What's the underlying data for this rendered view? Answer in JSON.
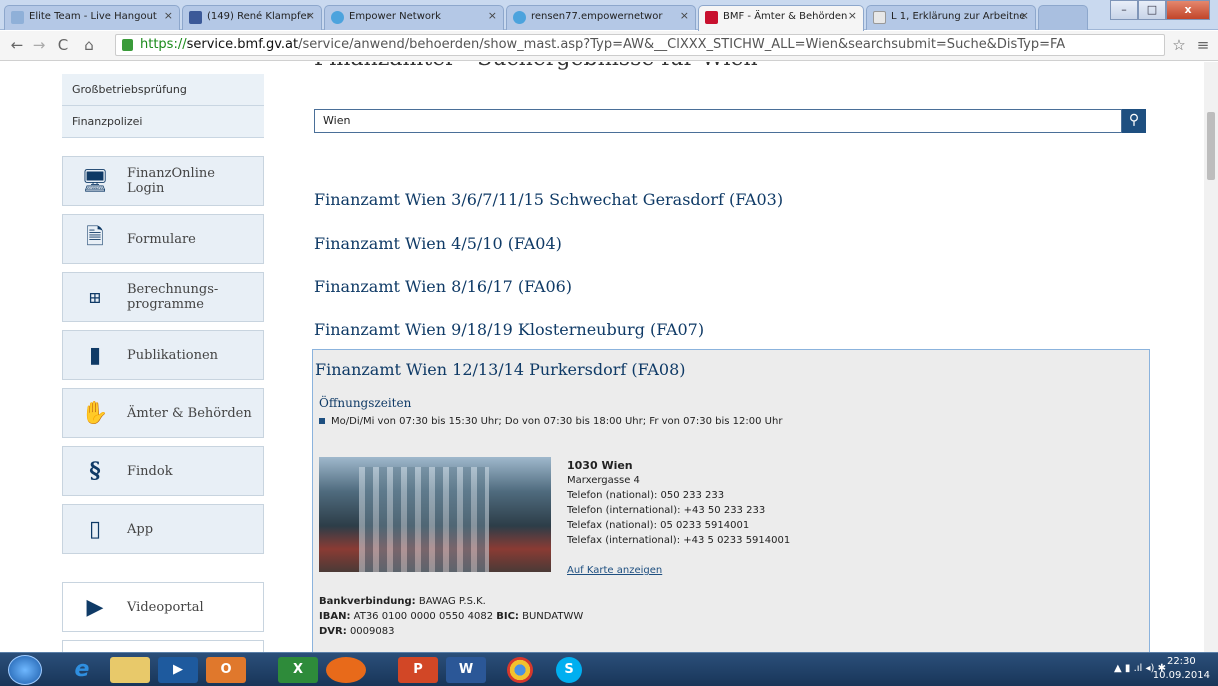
{
  "browser": {
    "tabs": [
      {
        "label": "Elite Team - Live Hangout"
      },
      {
        "label": "(149) René Klampfer"
      },
      {
        "label": "Empower Network"
      },
      {
        "label": "rensen77.empowernetwor"
      },
      {
        "label": "BMF - Ämter & Behörden"
      },
      {
        "label": "L 1, Erklärung zur Arbeitne"
      }
    ],
    "url_scheme": "https://",
    "url_host": "service.bmf.gv.at",
    "url_path": "/service/anwend/behoerden/show_mast.asp?Typ=AW&__ClXXX_STICHW_ALL=Wien&searchsubmit=Suche&DisTyp=FA"
  },
  "sidebar": {
    "categories": [
      "Großbetriebsprüfung",
      "Finanzpolizei"
    ],
    "cards": [
      {
        "line1": "FinanzOnline",
        "line2": "Login"
      },
      {
        "line1": "Formulare",
        "line2": ""
      },
      {
        "line1": "Berechnungs-",
        "line2": "programme"
      },
      {
        "line1": "Publikationen",
        "line2": ""
      },
      {
        "line1": "Ämter & Behörden",
        "line2": ""
      },
      {
        "line1": "Findok",
        "line2": ""
      },
      {
        "line1": "App",
        "line2": ""
      },
      {
        "line1": "Videoportal",
        "line2": ""
      }
    ]
  },
  "main": {
    "heading": "Finanzämter - Suchergebnisse für Wien",
    "search_value": "Wien",
    "results": [
      "Finanzamt Wien 3/6/7/11/15 Schwechat Gerasdorf (FA03)",
      "Finanzamt Wien 4/5/10 (FA04)",
      "Finanzamt Wien 8/16/17 (FA06)",
      "Finanzamt Wien 9/18/19 Klosterneuburg (FA07)"
    ],
    "detail": {
      "title": "Finanzamt Wien 12/13/14 Purkersdorf (FA08)",
      "hours_title": "Öffnungszeiten",
      "hours": "Mo/Di/Mi von 07:30 bis 15:30 Uhr; Do von 07:30 bis 18:00 Uhr; Fr von 07:30 bis 12:00 Uhr",
      "city": "1030 Wien",
      "street": "Marxergasse 4",
      "phone_national": "Telefon (national): 050 233 233",
      "phone_international": "Telefon (international): +43 50 233 233",
      "fax_national": "Telefax (national): 05 0233 5914001",
      "fax_international": "Telefax (international): +43 5 0233 5914001",
      "map_link": "Auf Karte anzeigen",
      "bank_label": "Bankverbindung:",
      "bank_value": "BAWAG P.S.K.",
      "iban_label": "IBAN:",
      "iban_value": "AT36 0100 0000 0550 4082",
      "bic_label": "BIC:",
      "bic_value": "BUNDATWW",
      "dvr_label": "DVR:",
      "dvr_value": "0009083"
    }
  },
  "taskbar": {
    "time": "22:30",
    "date": "10.09.2014"
  }
}
